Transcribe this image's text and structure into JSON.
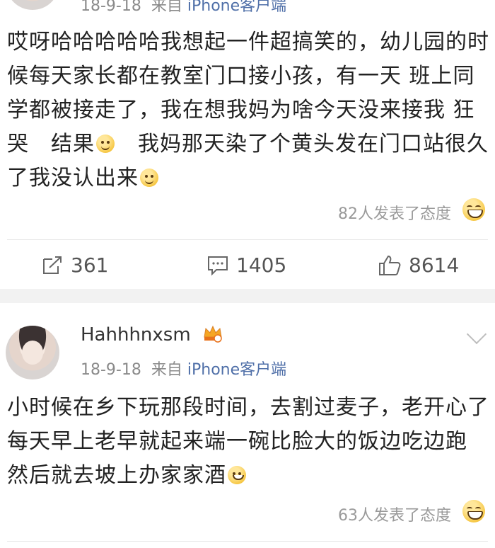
{
  "post1": {
    "meta": {
      "date": "18-9-18",
      "from_label": "来自",
      "source": "iPhone客户端"
    },
    "content": {
      "part1": "哎呀哈哈哈哈哈我想起一件超搞笑的，幼儿园的时候每天家长都在教室门口接小孩，有一天 班上同学都被接走了，我在想我妈为啥今天没来接我 狂哭　结果",
      "part2": "　我妈那天染了个黄头发在门口站很久了我没认出来"
    },
    "reactions": "82人发表了态度",
    "actions": {
      "repost": "361",
      "comment": "1405",
      "like": "8614"
    }
  },
  "post2": {
    "username": "Hahhhnxsm",
    "meta": {
      "date": "18-9-18",
      "from_label": "来自",
      "source": "iPhone客户端"
    },
    "content": "小时候在乡下玩那段时间，去割过麦子，老开心了　每天早上老早就起来端一碗比脸大的饭边吃边跑　然后就去坡上办家家酒",
    "reactions": "63人发表了态度"
  },
  "icons": [
    "smile-emoji-icon",
    "laugh-emoji-icon",
    "grin-emoji-icon",
    "repost-icon",
    "comment-icon",
    "like-icon",
    "crown-icon",
    "chevron-down-icon"
  ],
  "colors": {
    "source_link": "#4f6fa8",
    "meta_gray": "#8a8a8a",
    "separator": "#f2f2f2"
  }
}
